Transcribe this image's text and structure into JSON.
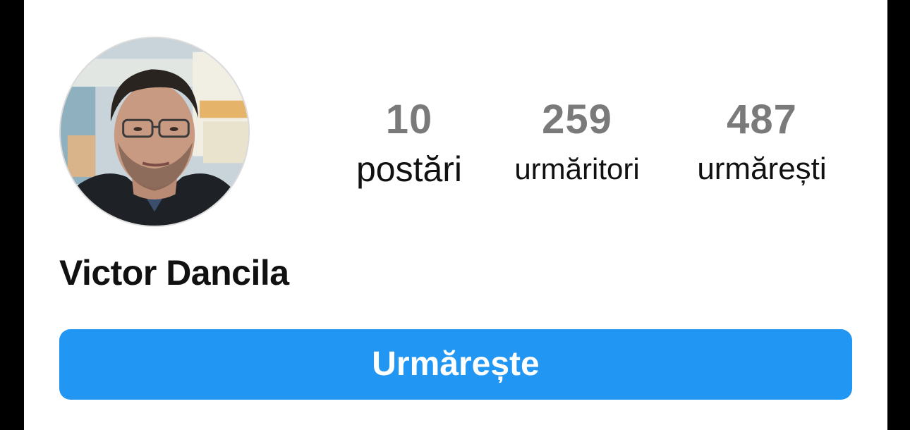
{
  "profile": {
    "name": "Victor Dancila",
    "avatar_icon": "profile-photo"
  },
  "stats": {
    "posts": {
      "count": "10",
      "label": "postări"
    },
    "followers": {
      "count": "259",
      "label": "urmăritori"
    },
    "following": {
      "count": "487",
      "label": "urmărești"
    }
  },
  "actions": {
    "follow_label": "Urmărește"
  },
  "colors": {
    "accent": "#2196F3",
    "count_text": "#7A7A7A",
    "label_text": "#111111",
    "frame": "#000000",
    "background": "#FFFFFF"
  }
}
